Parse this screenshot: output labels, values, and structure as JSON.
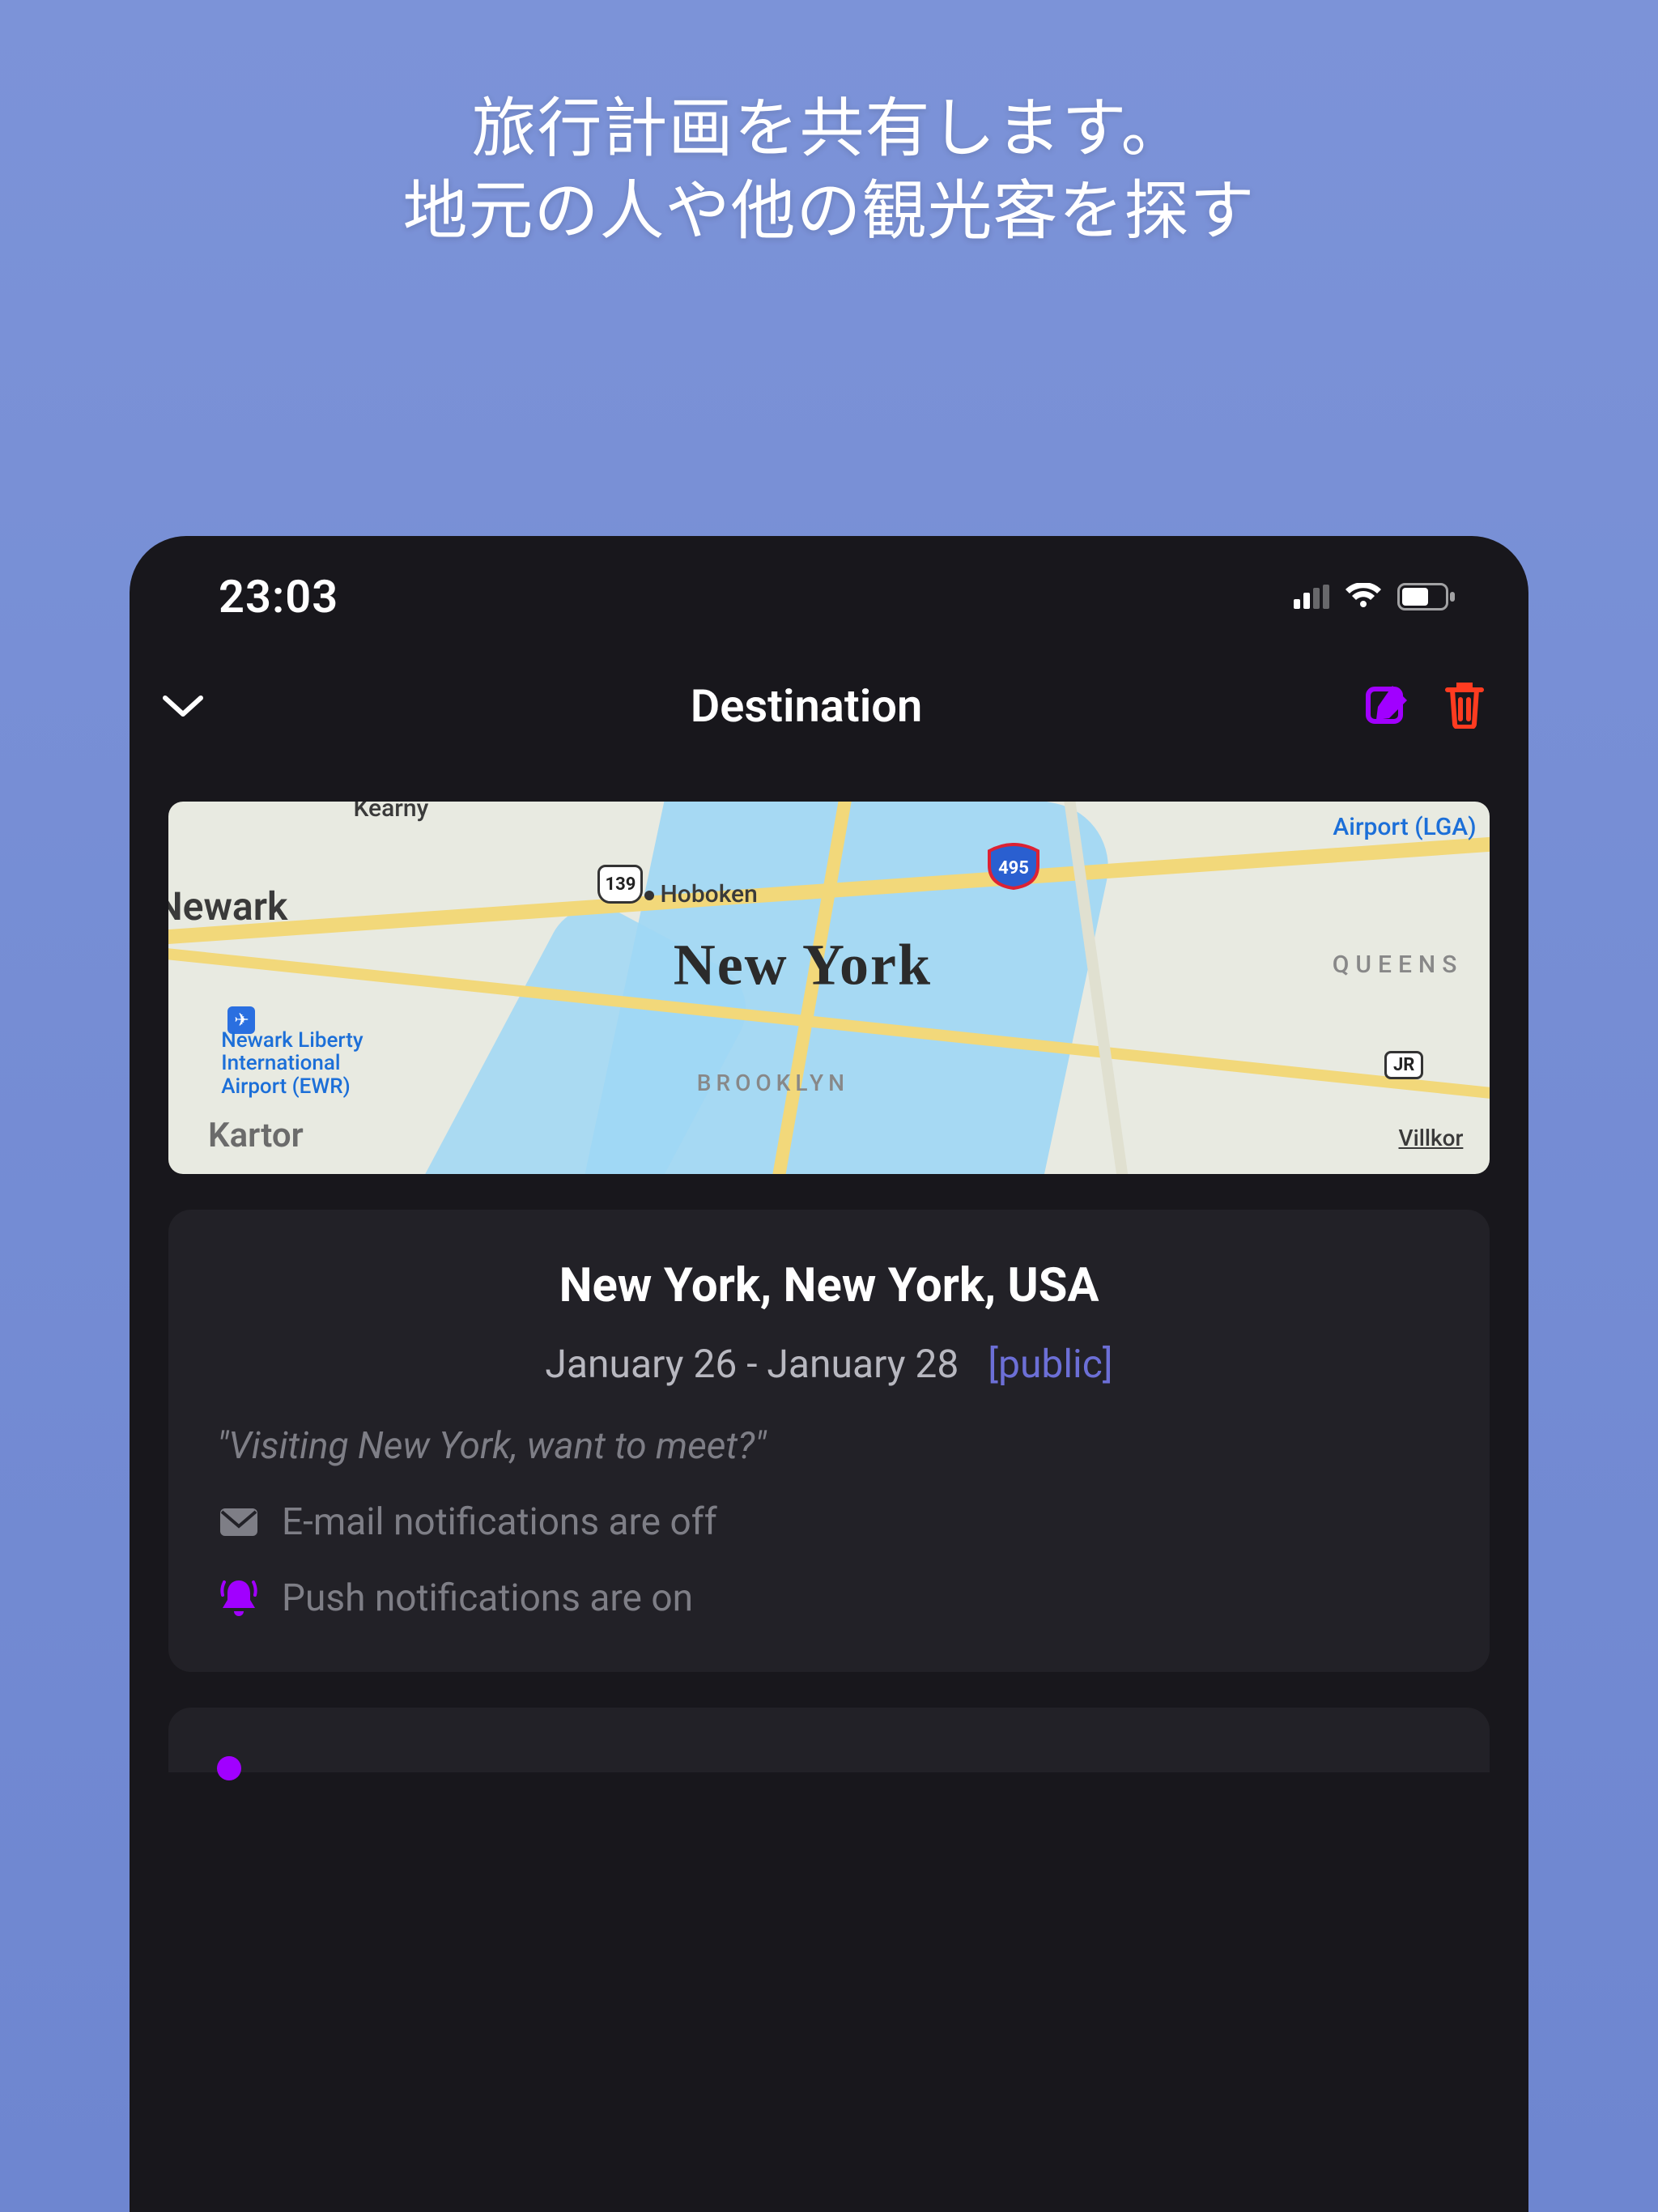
{
  "promo": {
    "line1": "旅行計画を共有します。",
    "line2": "地元の人や他の観光客を探す"
  },
  "status_bar": {
    "time": "23:03"
  },
  "nav": {
    "title": "Destination"
  },
  "map": {
    "city": "New York",
    "labels": {
      "hoboken": "Hoboken",
      "kearny": "Kearny",
      "newark": "Newark",
      "queens": "QUEENS",
      "brooklyn": "BROOKLYN",
      "lga": "Airport (LGA)",
      "nli": "Newark Liberty\nInternational\nAirport (EWR)",
      "villkor": "Villkor",
      "kartor": "Kartor",
      "route139": "139",
      "route495": "495",
      "jr": "JR"
    }
  },
  "destination": {
    "location": "New York, New York, USA",
    "date_range": "January 26 - January 28",
    "visibility": "[public]",
    "message": "\"Visiting New York, want to meet?\"",
    "email_notifications": "E-mail notifications are off",
    "push_notifications": "Push notifications are on"
  }
}
